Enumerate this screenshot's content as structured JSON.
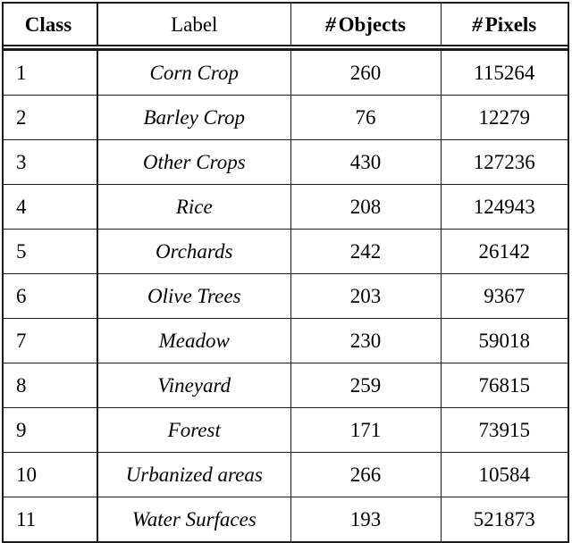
{
  "table": {
    "columns": [
      {
        "key": "class",
        "label": "Class",
        "bold": true,
        "align": "left"
      },
      {
        "key": "label",
        "label": "Label",
        "bold": false,
        "align": "center"
      },
      {
        "key": "objects",
        "hash": "#",
        "label": "Objects",
        "bold": true,
        "align": "center"
      },
      {
        "key": "pixels",
        "hash": "#",
        "label": "Pixels",
        "bold": true,
        "align": "center"
      }
    ],
    "header": {
      "class": "Class",
      "label": "Label",
      "objects_hash": "#",
      "objects": "Objects",
      "pixels_hash": "#",
      "pixels": "Pixels"
    },
    "rows": [
      {
        "class": "1",
        "label": "Corn Crop",
        "objects": "260",
        "pixels": "115264"
      },
      {
        "class": "2",
        "label": "Barley Crop",
        "objects": "76",
        "pixels": "12279"
      },
      {
        "class": "3",
        "label": "Other Crops",
        "objects": "430",
        "pixels": "127236"
      },
      {
        "class": "4",
        "label": "Rice",
        "objects": "208",
        "pixels": "124943"
      },
      {
        "class": "5",
        "label": "Orchards",
        "objects": "242",
        "pixels": "26142"
      },
      {
        "class": "6",
        "label": "Olive Trees",
        "objects": "203",
        "pixels": "9367"
      },
      {
        "class": "7",
        "label": "Meadow",
        "objects": "230",
        "pixels": "59018"
      },
      {
        "class": "8",
        "label": "Vineyard",
        "objects": "259",
        "pixels": "76815"
      },
      {
        "class": "9",
        "label": "Forest",
        "objects": "171",
        "pixels": "73915"
      },
      {
        "class": "10",
        "label": "Urbanized areas",
        "objects": "266",
        "pixels": "10584"
      },
      {
        "class": "11",
        "label": "Water Surfaces",
        "objects": "193",
        "pixels": "521873"
      }
    ]
  },
  "style": {
    "rule_color": "#1a1a1a",
    "background": "#ffffff",
    "text_color": "#000000"
  }
}
